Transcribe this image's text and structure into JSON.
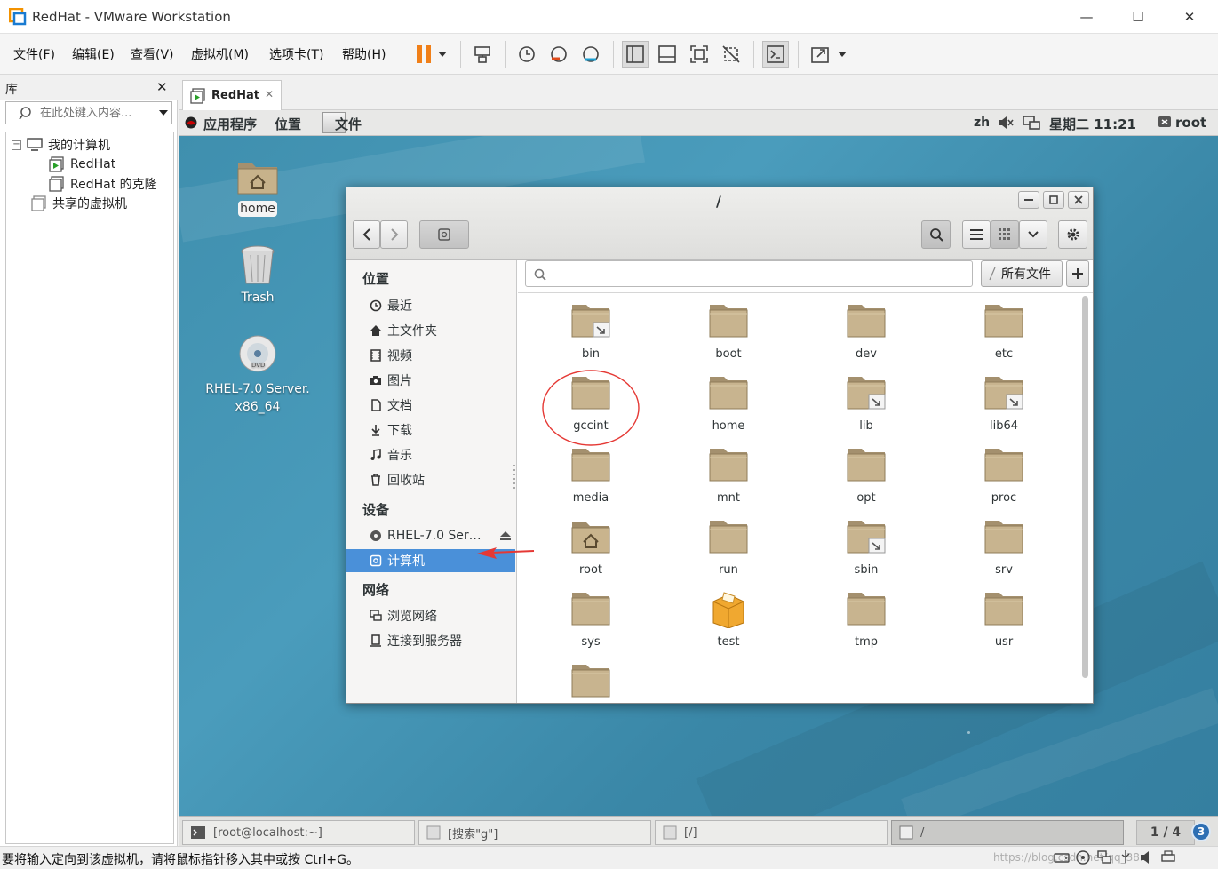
{
  "window": {
    "title": "RedHat - VMware Workstation",
    "minimize": "—",
    "maximize": "☐",
    "close": "✕"
  },
  "menu": [
    "文件(F)",
    "编辑(E)",
    "查看(V)",
    "虚拟机(M)",
    "选项卡(T)",
    "帮助(H)"
  ],
  "library": {
    "title": "库",
    "close": "✕",
    "search_placeholder": "在此处键入内容...",
    "tree": [
      {
        "label": "我的计算机"
      },
      {
        "label": "RedHat"
      },
      {
        "label": "RedHat 的克隆"
      },
      {
        "label": "共享的虚拟机"
      }
    ]
  },
  "vm_tab": {
    "label": "RedHat",
    "close": "✕"
  },
  "gnome_topbar": {
    "apps": "应用程序",
    "places": "位置",
    "files": "文件",
    "lang": "zh",
    "clock": "星期二 11:21",
    "user": "root"
  },
  "desktop_icons": [
    {
      "label": "home"
    },
    {
      "label": "Trash"
    },
    {
      "label": "RHEL-7.0 Server.\nx86_64"
    }
  ],
  "nautilus": {
    "title": "/",
    "filter": "所有文件",
    "sidebar": {
      "places_header": "位置",
      "places": [
        "最近",
        "主文件夹",
        "视频",
        "图片",
        "文档",
        "下载",
        "音乐",
        "回收站"
      ],
      "devices_header": "设备",
      "devices": [
        "RHEL-7.0 Ser…",
        "计算机"
      ],
      "network_header": "网络",
      "network": [
        "浏览网络",
        "连接到服务器"
      ]
    },
    "files": [
      "bin",
      "boot",
      "dev",
      "etc",
      "gccint",
      "home",
      "lib",
      "lib64",
      "media",
      "mnt",
      "opt",
      "proc",
      "root",
      "run",
      "sbin",
      "srv",
      "sys",
      "test",
      "tmp",
      "usr",
      ""
    ]
  },
  "taskbar": {
    "tasks": [
      "[root@localhost:~]",
      "[搜索\"g\"]",
      "[/]",
      "/"
    ],
    "workspace": "1 / 4",
    "badge": "3"
  },
  "statusbar": {
    "text": "要将输入定向到该虚拟机，请将鼠标指针移入其中或按 Ctrl+G。",
    "watermark": "https://blog.csdn.net/qq_38..."
  },
  "colors": {
    "selection": "#4a90d9",
    "desktop": "#3f8fae",
    "annotation": "#e53935"
  }
}
